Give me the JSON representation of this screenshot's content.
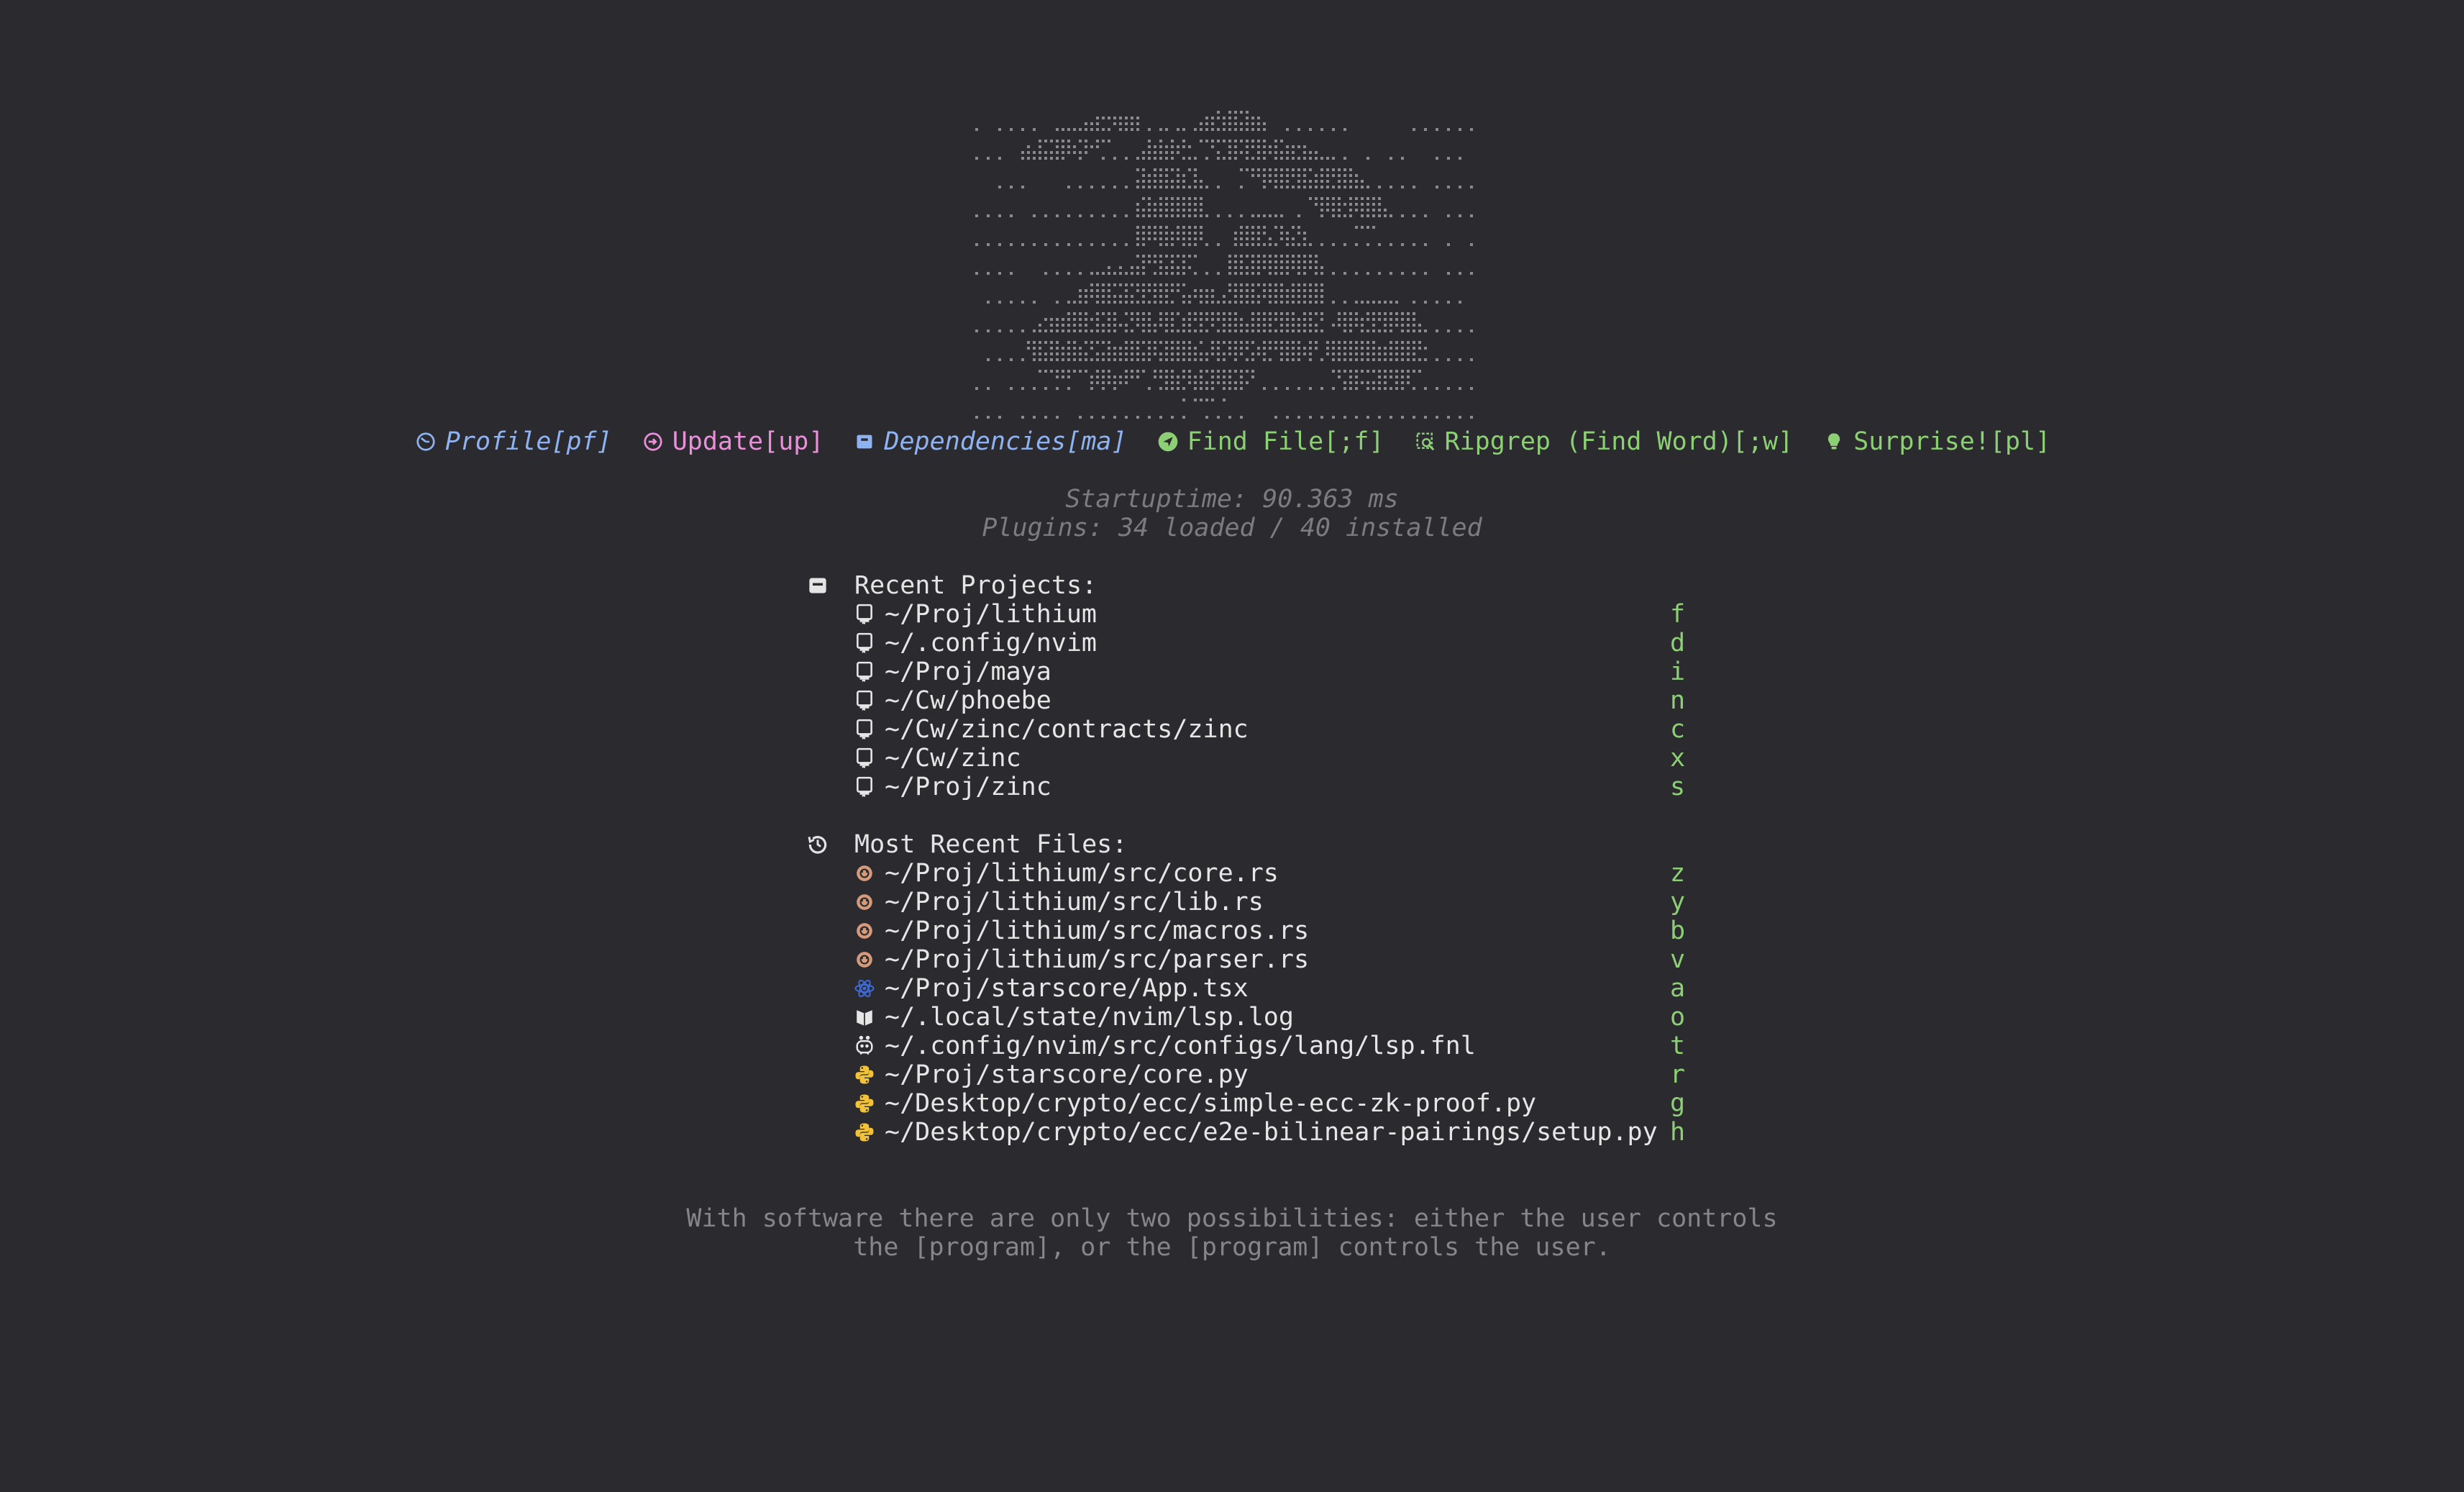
{
  "buttons": [
    {
      "label": "Profile[pf]",
      "icon": "profile-icon",
      "color": "#8fb3f0",
      "italic": true
    },
    {
      "label": "Update[up]",
      "icon": "update-icon",
      "color": "#ea8fd9",
      "italic": false
    },
    {
      "label": "Dependencies[ma]",
      "icon": "package-icon",
      "color": "#8fb3f0",
      "italic": true
    },
    {
      "label": "Find File[;f]",
      "icon": "telescope-icon",
      "color": "#8ccf74",
      "italic": false
    },
    {
      "label": "Ripgrep (Find Word)[;w]",
      "icon": "search-icon",
      "color": "#8ccf74",
      "italic": false
    },
    {
      "label": "Surprise![pl]",
      "icon": "lightbulb-icon",
      "color": "#8ccf74",
      "italic": false
    }
  ],
  "stats": {
    "startuptime": "Startuptime: 90.363 ms",
    "plugins": "Plugins: 34 loaded / 40 installed"
  },
  "projects": {
    "title": "Recent Projects:",
    "icon": "folder-icon",
    "items": [
      {
        "path": "~/Proj/lithium",
        "key": "f"
      },
      {
        "path": "~/.config/nvim",
        "key": "d"
      },
      {
        "path": "~/Proj/maya",
        "key": "i"
      },
      {
        "path": "~/Cw/phoebe",
        "key": "n"
      },
      {
        "path": "~/Cw/zinc/contracts/zinc",
        "key": "c"
      },
      {
        "path": "~/Cw/zinc",
        "key": "x"
      },
      {
        "path": "~/Proj/zinc",
        "key": "s"
      }
    ]
  },
  "files": {
    "title": "Most Recent Files:",
    "icon": "history-icon",
    "items": [
      {
        "path": "~/Proj/lithium/src/core.rs",
        "key": "z",
        "icon": "rust-icon"
      },
      {
        "path": "~/Proj/lithium/src/lib.rs",
        "key": "y",
        "icon": "rust-icon"
      },
      {
        "path": "~/Proj/lithium/src/macros.rs",
        "key": "b",
        "icon": "rust-icon"
      },
      {
        "path": "~/Proj/lithium/src/parser.rs",
        "key": "v",
        "icon": "rust-icon"
      },
      {
        "path": "~/Proj/starscore/App.tsx",
        "key": "a",
        "icon": "react-icon"
      },
      {
        "path": "~/.local/state/nvim/lsp.log",
        "key": "o",
        "icon": "log-icon"
      },
      {
        "path": "~/.config/nvim/src/configs/lang/lsp.fnl",
        "key": "t",
        "icon": "fennel-icon"
      },
      {
        "path": "~/Proj/starscore/core.py",
        "key": "r",
        "icon": "python-icon"
      },
      {
        "path": "~/Desktop/crypto/ecc/simple-ecc-zk-proof.py",
        "key": "g",
        "icon": "python-icon"
      },
      {
        "path": "~/Desktop/crypto/ecc/e2e-bilinear-pairings/setup.py",
        "key": "h",
        "icon": "python-icon"
      }
    ]
  },
  "quote": {
    "line1": "With software there are only two possibilities: either the user controls",
    "line2": "the [program], or the [program] controls the user."
  }
}
